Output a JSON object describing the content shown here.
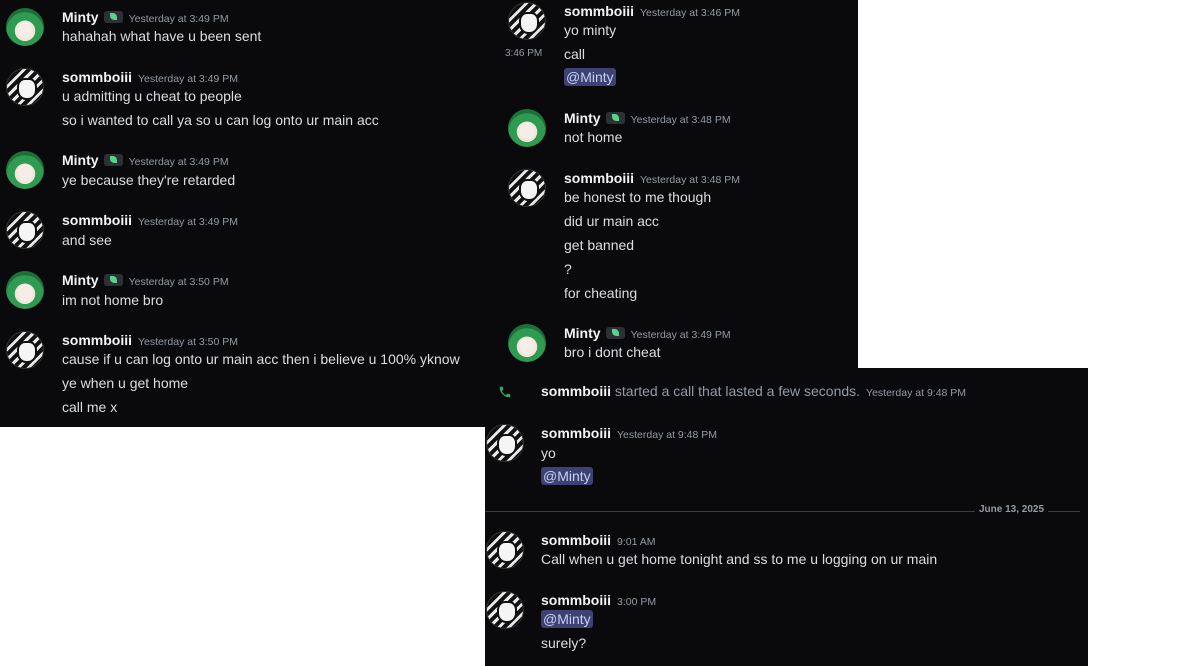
{
  "panel_a": {
    "messages": [
      {
        "user": "Minty",
        "badge": true,
        "time": "Yesterday at 3:49 PM",
        "lines": [
          "hahahah what have u been sent"
        ]
      },
      {
        "user": "sommboiii",
        "badge": false,
        "time": "Yesterday at 3:49 PM",
        "lines": [
          "u admitting u cheat to people",
          "so i wanted to call ya so u can log onto ur main acc"
        ]
      },
      {
        "user": "Minty",
        "badge": true,
        "time": "Yesterday at 3:49 PM",
        "lines": [
          "ye because they're retarded"
        ]
      },
      {
        "user": "sommboiii",
        "badge": false,
        "time": "Yesterday at 3:49 PM",
        "lines": [
          "and see"
        ]
      },
      {
        "user": "Minty",
        "badge": true,
        "time": "Yesterday at 3:50 PM",
        "lines": [
          "im not home bro"
        ]
      },
      {
        "user": "sommboiii",
        "badge": false,
        "time": "Yesterday at 3:50 PM",
        "lines": [
          "cause if u can log onto ur main acc then i believe u 100% yknow",
          "ye when u get home",
          "call me x"
        ]
      }
    ]
  },
  "panel_b": {
    "messages": [
      {
        "user": "sommboiii",
        "badge": false,
        "time": "Yesterday at 3:46 PM",
        "lines": [
          "yo minty"
        ]
      },
      {
        "side_time": "3:46 PM",
        "line": "call"
      },
      {
        "mention": "@Minty"
      },
      {
        "user": "Minty",
        "badge": true,
        "time": "Yesterday at 3:48 PM",
        "lines": [
          "not home"
        ]
      },
      {
        "user": "sommboiii",
        "badge": false,
        "time": "Yesterday at 3:48 PM",
        "lines": [
          "be honest to me though",
          "did ur main acc",
          "get banned",
          "?",
          "for cheating"
        ]
      },
      {
        "user": "Minty",
        "badge": true,
        "time": "Yesterday at 3:49 PM",
        "lines": [
          "bro i dont cheat"
        ]
      }
    ]
  },
  "panel_c": {
    "system": {
      "user": "sommboiii",
      "text": "started a call that lasted a few seconds.",
      "time": "Yesterday at 9:48 PM",
      "icon": "phone-icon",
      "color": "#3ba55d"
    },
    "messages": [
      {
        "user": "sommboiii",
        "time": "Yesterday at 9:48 PM",
        "lines": [
          "yo"
        ],
        "mention": "@Minty"
      },
      {
        "user": "sommboiii",
        "time": "9:01 AM",
        "lines": [
          "Call when u get home tonight and ss to me u logging on ur main"
        ]
      },
      {
        "user": "sommboiii",
        "time": "3:00 PM",
        "mention": "@Minty",
        "lines": [
          "surely?"
        ]
      }
    ],
    "divider_date": "June 13, 2025"
  },
  "colors": {
    "bg": "#0a0a0c",
    "mention_bg": "#3d4270",
    "call_green": "#3ba55d"
  }
}
